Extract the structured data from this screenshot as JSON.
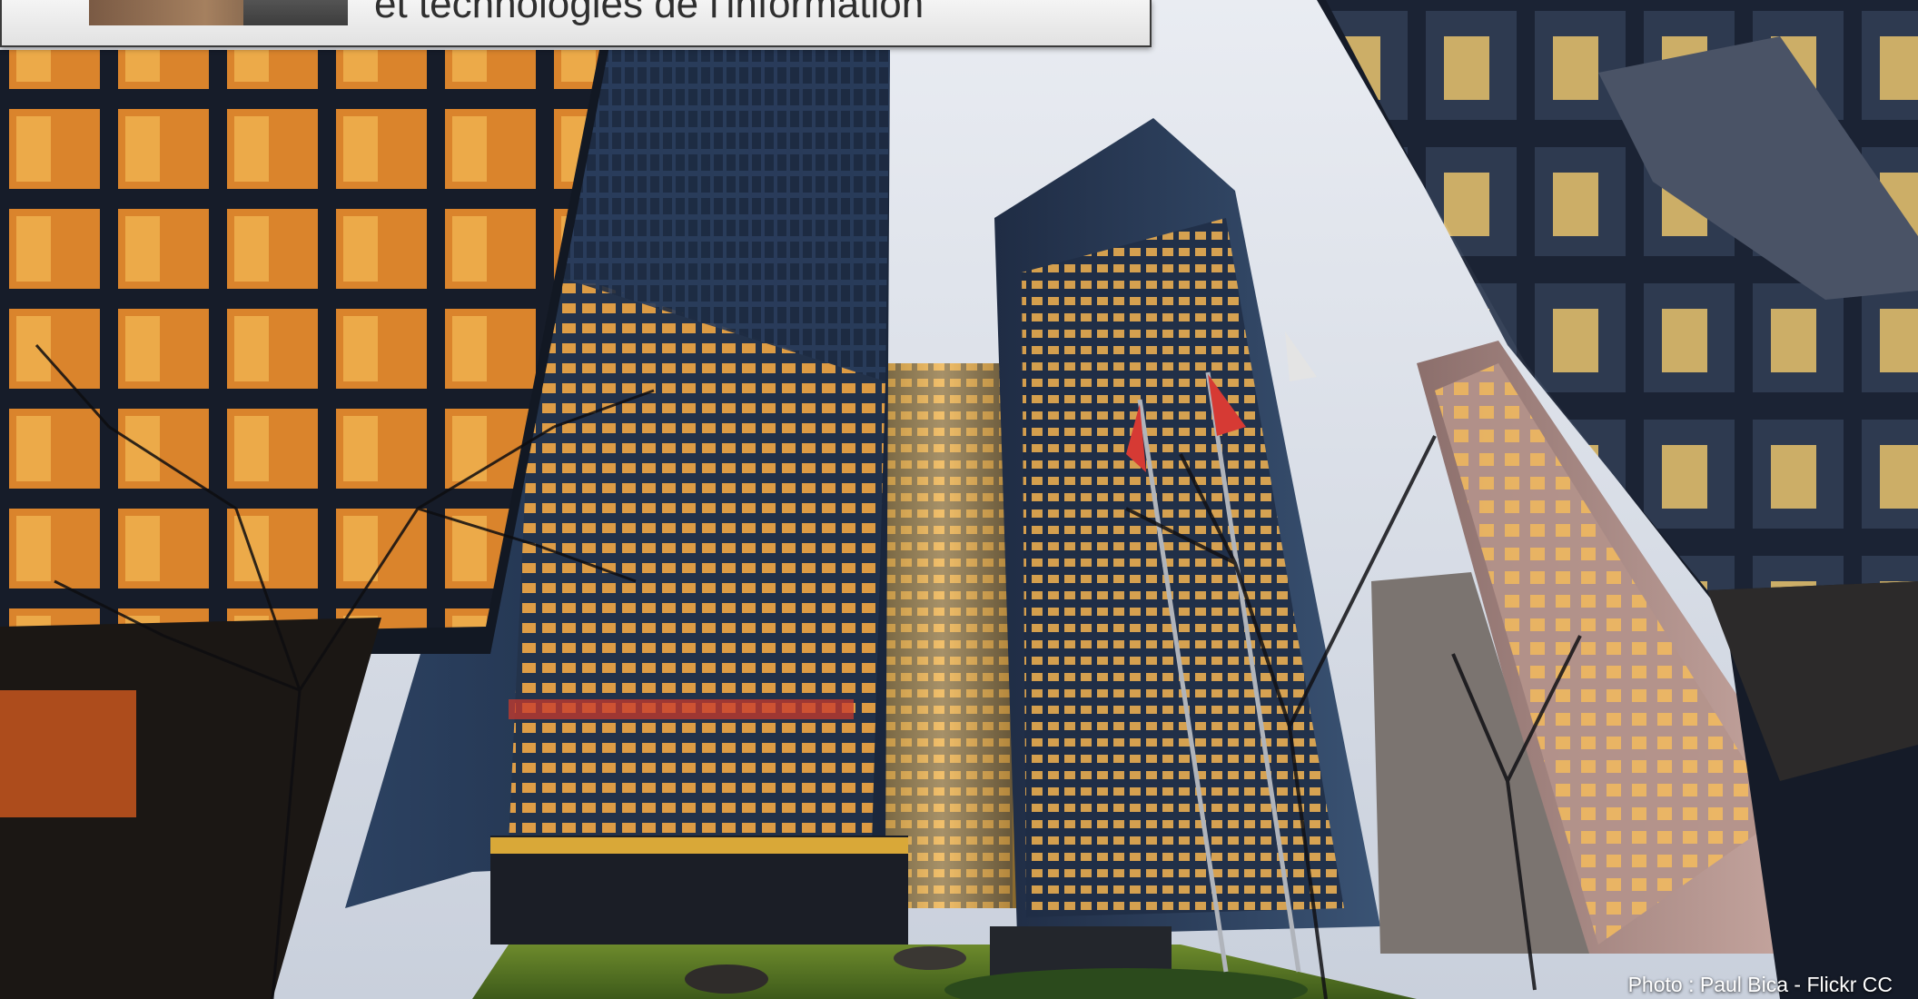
{
  "header": {
    "title_text": "et technologies de l'information"
  },
  "photo": {
    "credit": "Photo : Paul Bica - Flickr CC"
  }
}
